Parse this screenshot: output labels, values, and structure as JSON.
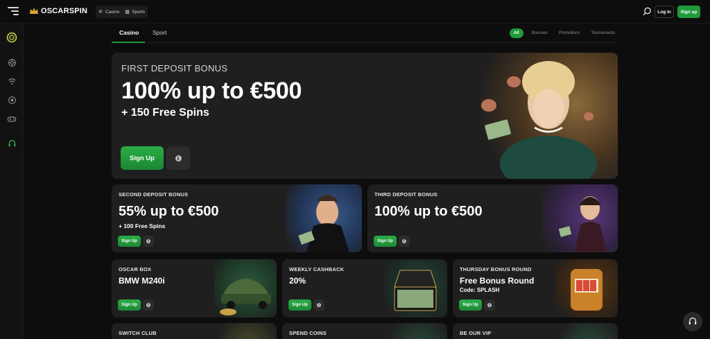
{
  "header": {
    "logo_text": "OSCARSPIN",
    "nav": [
      {
        "label": "Casino",
        "icon": "casino-chip-icon"
      },
      {
        "label": "Sports",
        "icon": "sports-grid-icon"
      }
    ],
    "login_label": "Log in",
    "signup_label": "Sign up"
  },
  "sidebar": {
    "items": [
      {
        "name": "sidebar-oscar-icon",
        "icon": "ring-icon",
        "active": true
      },
      {
        "name": "sidebar-casino-icon",
        "icon": "chip-icon"
      },
      {
        "name": "sidebar-live-icon",
        "icon": "wifi-icon"
      },
      {
        "name": "sidebar-sports-icon",
        "icon": "football-icon"
      },
      {
        "name": "sidebar-games-icon",
        "icon": "gamepad-icon"
      },
      {
        "name": "sidebar-support-icon",
        "icon": "headset-icon"
      }
    ]
  },
  "tabs": {
    "main": [
      "Casino",
      "Sport"
    ],
    "filters": [
      "All",
      "Bonuses",
      "Promotions",
      "Tournaments"
    ],
    "active_filter": "All"
  },
  "hero": {
    "eyebrow": "FIRST DEPOSIT BONUS",
    "headline": "100% up to €500",
    "sub": "+ 150 Free Spins",
    "button": "Sign Up"
  },
  "cards": {
    "second": {
      "title": "SECOND DEPOSIT BONUS",
      "value": "55% up to €500",
      "sub": "+ 100 Free Spins",
      "button": "Sign Up"
    },
    "third": {
      "title": "THIRD DEPOSIT BONUS",
      "value": "100% up to €500",
      "button": "Sign Up"
    },
    "oscar_box": {
      "title": "OSCAR BOX",
      "value": "BMW M240i",
      "button": "Sign Up"
    },
    "weekly": {
      "title": "WEEKLY CASHBACK",
      "value": "20%",
      "button": "Sign Up"
    },
    "thursday": {
      "title": "THURSDAY BONUS ROUND",
      "value": "Free Bonus Round",
      "sub": "Code: SPLASH",
      "button": "Sign Up"
    },
    "switch": {
      "title": "SWITCH CLUB"
    },
    "spend": {
      "title": "SPEND COINS"
    },
    "vip": {
      "title": "BE OUR VIP"
    }
  },
  "colors": {
    "accent": "#1f9a3b",
    "bg": "#0d0d0d",
    "card": "#1f1f1f"
  }
}
